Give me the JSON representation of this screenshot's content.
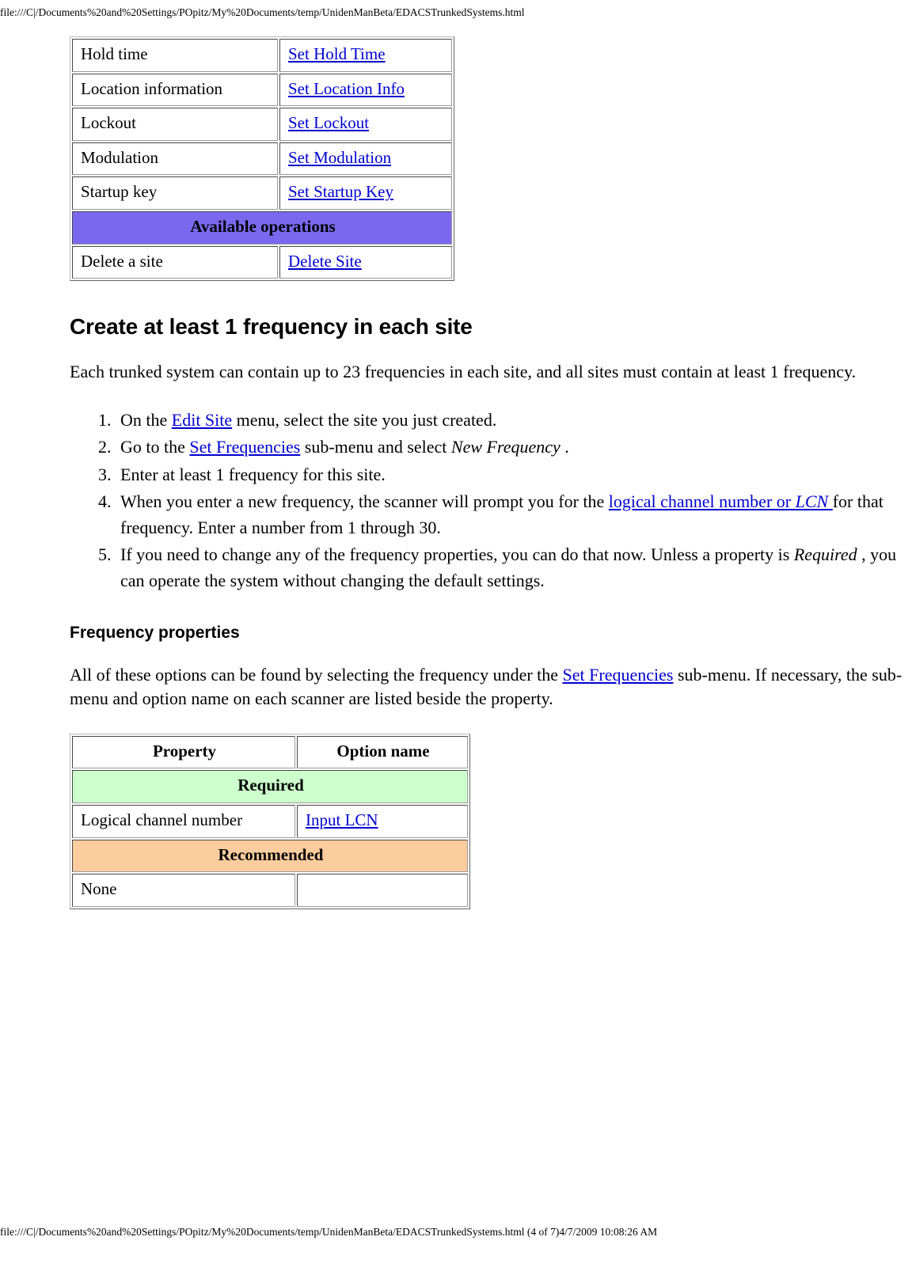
{
  "browser": {
    "header_path": "file:///C|/Documents%20and%20Settings/POpitz/My%20Documents/temp/UnidenManBeta/EDACSTrunkedSystems.html",
    "footer_path": "file:///C|/Documents%20and%20Settings/POpitz/My%20Documents/temp/UnidenManBeta/EDACSTrunkedSystems.html (4 of 7)4/7/2009 10:08:26 AM"
  },
  "colors": {
    "link": "#0000d0",
    "section_purple": "#7b68ee",
    "section_green": "#ccffcc",
    "section_orange": "#fbcd9e",
    "border_outer": "#b8b8b8",
    "border_inner": "#9a9a9a"
  },
  "site_table": {
    "rows": [
      {
        "property": "Hold time",
        "option": "Set Hold Time"
      },
      {
        "property": "Location information",
        "option": "Set Location Info"
      },
      {
        "property": "Lockout",
        "option": "Set Lockout"
      },
      {
        "property": "Modulation",
        "option": "Set Modulation"
      },
      {
        "property": "Startup key",
        "option": "Set Startup Key"
      }
    ],
    "section_header": "Available operations",
    "operations": [
      {
        "property": "Delete a site",
        "option": "Delete Site"
      }
    ]
  },
  "heading": "Create at least 1 frequency in each site",
  "intro_paragraph": "Each trunked system can contain up to 23 frequencies in each site, and all sites must contain at least 1 frequency.",
  "steps": {
    "item1": {
      "pre": "On the ",
      "link": "Edit Site",
      "post": " menu, select the site you just created."
    },
    "item2": {
      "pre": "Go to the ",
      "link": "Set Frequencies",
      "mid": " sub-menu and select ",
      "italic": "New Frequency",
      "post": " ."
    },
    "item3": {
      "text": "Enter at least 1 frequency for this site."
    },
    "item4": {
      "pre": "When you enter a new frequency, the scanner will prompt you for the ",
      "link_a": "logical channel number or ",
      "link_b_italic": "LCN",
      "post": " for that frequency. Enter a number from 1 through 30."
    },
    "item5": {
      "pre": "If you need to change any of the frequency properties, you can do that now. Unless a property is ",
      "italic": "Required",
      "post": " , you can operate the system without changing the default settings."
    }
  },
  "subheading": "Frequency properties",
  "properties_paragraph": {
    "pre": "All of these options can be found by selecting the frequency under the ",
    "link": "Set Frequencies",
    "post": " sub-menu. If necessary, the sub-menu and option name on each scanner are listed beside the property."
  },
  "property_table": {
    "col_headers": [
      "Property",
      "Option name"
    ],
    "required_header": "Required",
    "required_rows": [
      {
        "property": "Logical channel number",
        "option": "Input LCN"
      }
    ],
    "recommended_header": "Recommended",
    "recommended_rows": [
      {
        "property": "None",
        "option": ""
      }
    ]
  }
}
